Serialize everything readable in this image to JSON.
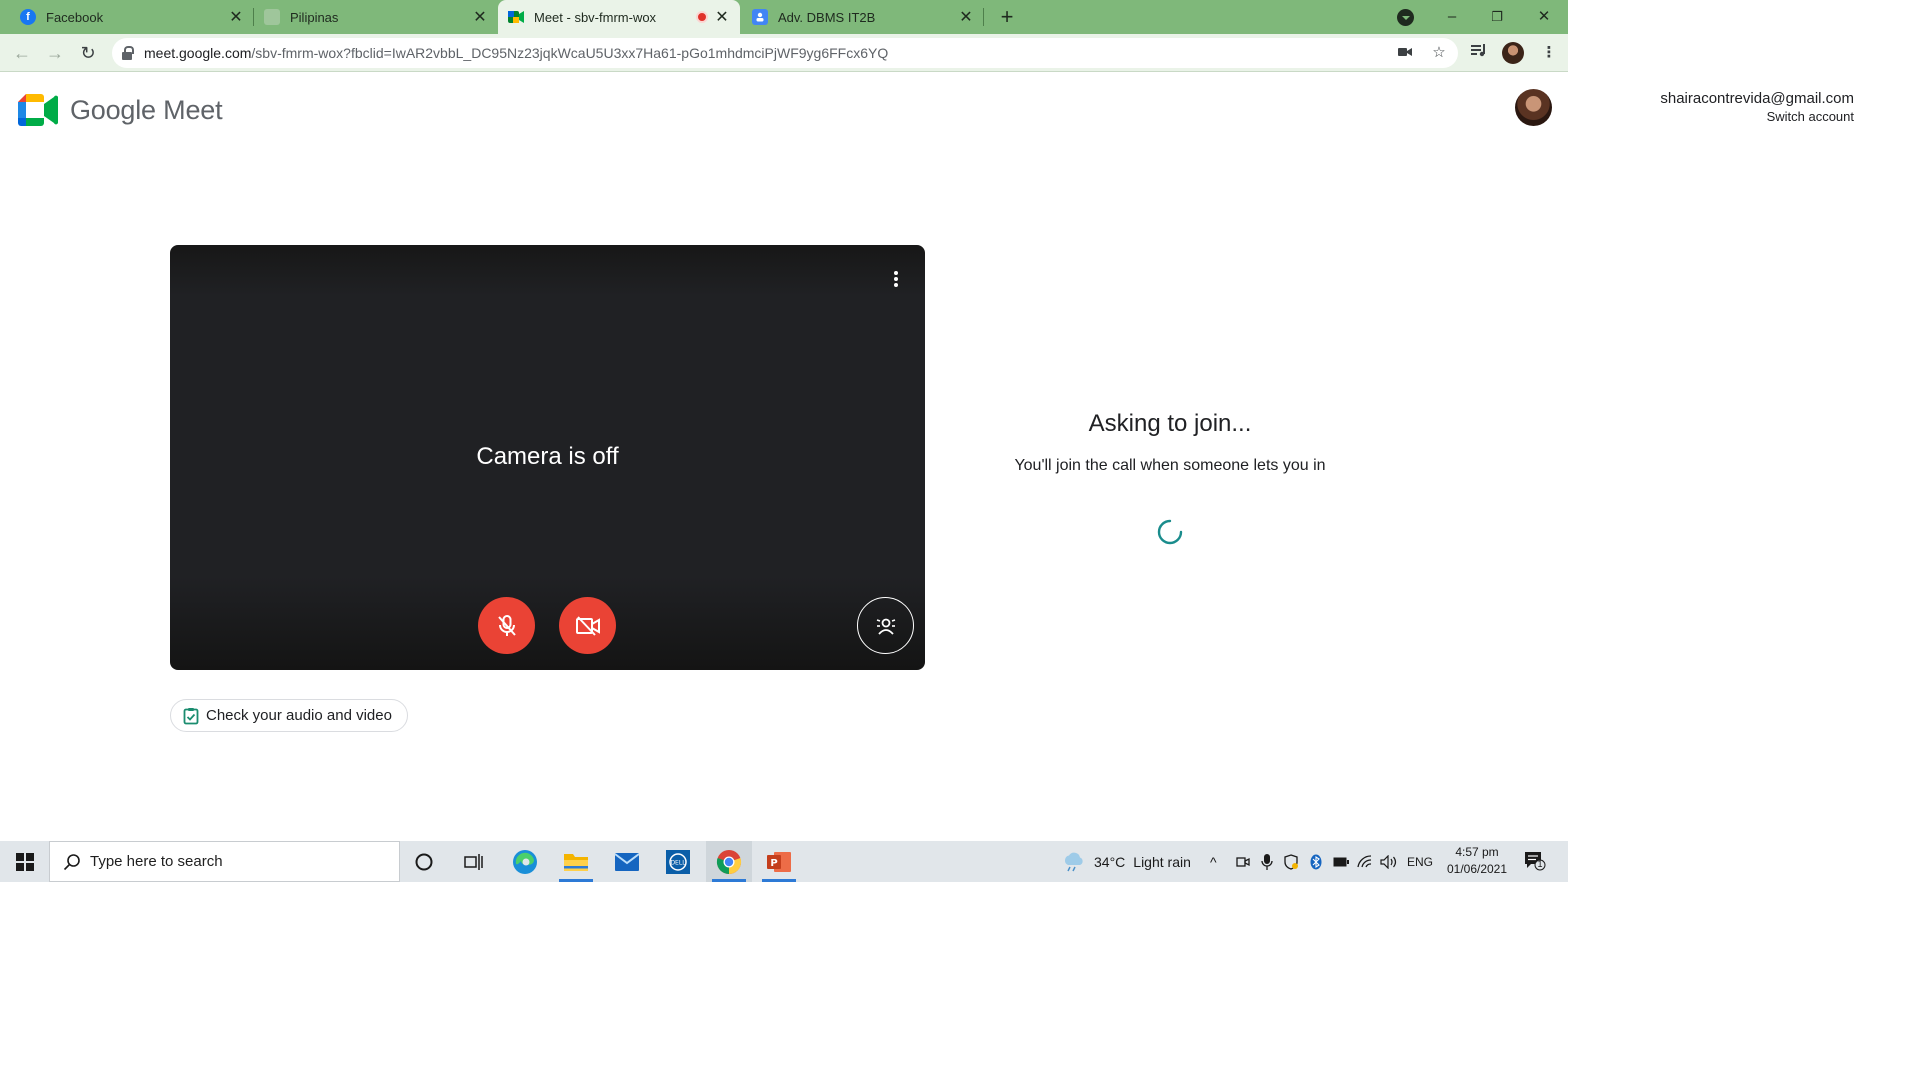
{
  "browser": {
    "tabs": [
      {
        "title": "Facebook",
        "favicon": "facebook-icon",
        "active": false
      },
      {
        "title": "Pilipinas",
        "favicon": "page-icon",
        "active": false
      },
      {
        "title": "Meet - sbv-fmrm-wox",
        "favicon": "google-meet-icon",
        "active": true,
        "recording": true
      },
      {
        "title": "Adv. DBMS IT2B",
        "favicon": "google-classroom-icon",
        "active": false
      }
    ],
    "url_host": "meet.google.com",
    "url_path": "/sbv-fmrm-wox?fbclid=IwAR2vbbL_DC95Nz23jqkWcaU5U3xx7Ha61-pGo1mhdmciPjWF9yg6FFcx6YQ",
    "theme_color": "#7fb87a"
  },
  "meet": {
    "brand": "Google Meet",
    "account_email": "shairacontrevida@gmail.com",
    "switch_account": "Switch account",
    "camera_status": "Camera is off",
    "check_audio_video": "Check your audio and video",
    "join_heading": "Asking to join...",
    "join_message": "You'll join the call when someone lets you in",
    "mic_muted": true,
    "camera_off": true,
    "accent_red": "#ea4335",
    "spinner_color": "#1a8c8c"
  },
  "taskbar": {
    "search_placeholder": "Type here to search",
    "weather_temp": "34°C",
    "weather_desc": "Light rain",
    "language": "ENG",
    "time": "4:57 pm",
    "date": "01/06/2021",
    "notification_count": "1",
    "pinned_apps": [
      "cortana-icon",
      "task-view-icon",
      "edge-icon",
      "file-explorer-icon",
      "mail-icon",
      "dell-icon",
      "chrome-icon",
      "powerpoint-icon"
    ]
  }
}
